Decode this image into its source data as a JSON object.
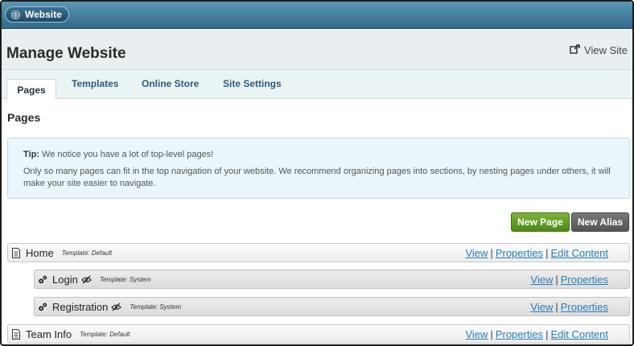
{
  "topbar": {
    "site_label": "Website"
  },
  "header": {
    "title": "Manage Website",
    "view_site": "View Site"
  },
  "tabs": [
    {
      "label": "Pages"
    },
    {
      "label": "Templates"
    },
    {
      "label": "Online Store"
    },
    {
      "label": "Site Settings"
    }
  ],
  "section": {
    "title": "Pages"
  },
  "tip": {
    "label": "Tip:",
    "heading": "We notice you have a lot of top-level pages!",
    "body": "Only so many pages can fit in the top navigation of your website. We recommend organizing pages into sections, by nesting pages under others, it will make your site easier to navigate."
  },
  "actions": {
    "new_page": "New Page",
    "new_alias": "New Alias"
  },
  "pages": [
    {
      "name": "Home",
      "template": "Template: Default",
      "links": [
        "View",
        "Properties",
        "Edit Content"
      ]
    },
    {
      "name": "Login",
      "template": "Template: System",
      "links": [
        "View",
        "Properties"
      ]
    },
    {
      "name": "Registration",
      "template": "Template: System",
      "links": [
        "View",
        "Properties"
      ]
    },
    {
      "name": "Team Info",
      "template": "Template: Default",
      "links": [
        "View",
        "Properties",
        "Edit Content"
      ]
    }
  ],
  "link_separator": "|"
}
